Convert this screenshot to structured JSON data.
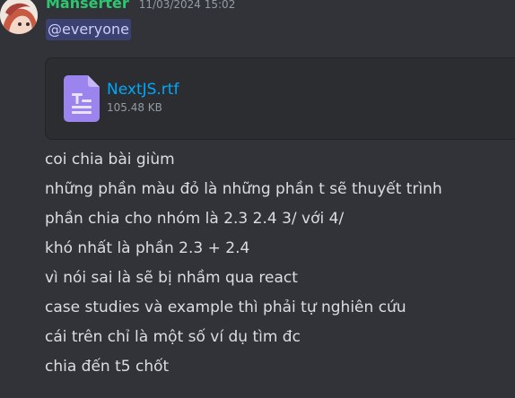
{
  "message": {
    "author": "Manserter",
    "timestamp": "11/03/2024 15:02",
    "mention": "@everyone",
    "attachment": {
      "file_name": "NextJS.rtf",
      "file_size": "105.48 KB",
      "icon": "text-document-icon"
    },
    "lines": [
      "coi chia bài giùm",
      "những phần màu đỏ là những phần t sẽ thuyết trình",
      "phần chia cho nhóm là 2.3 2.4 3/ với 4/",
      "khó nhất là phần 2.3 + 2.4",
      "vì nói sai là sẽ bị nhầm qua react",
      "case studies và example thì phải tự nghiên cứu",
      "cái trên chỉ là một số ví dụ tìm đc",
      "chia đến t5 chốt"
    ]
  },
  "colors": {
    "background": "#313338",
    "author": "#2dc770",
    "mention_bg": "#3c4270",
    "link": "#00a8fc",
    "text": "#dbdee1",
    "muted": "#949ba4",
    "file_icon": "#9b84ee"
  }
}
